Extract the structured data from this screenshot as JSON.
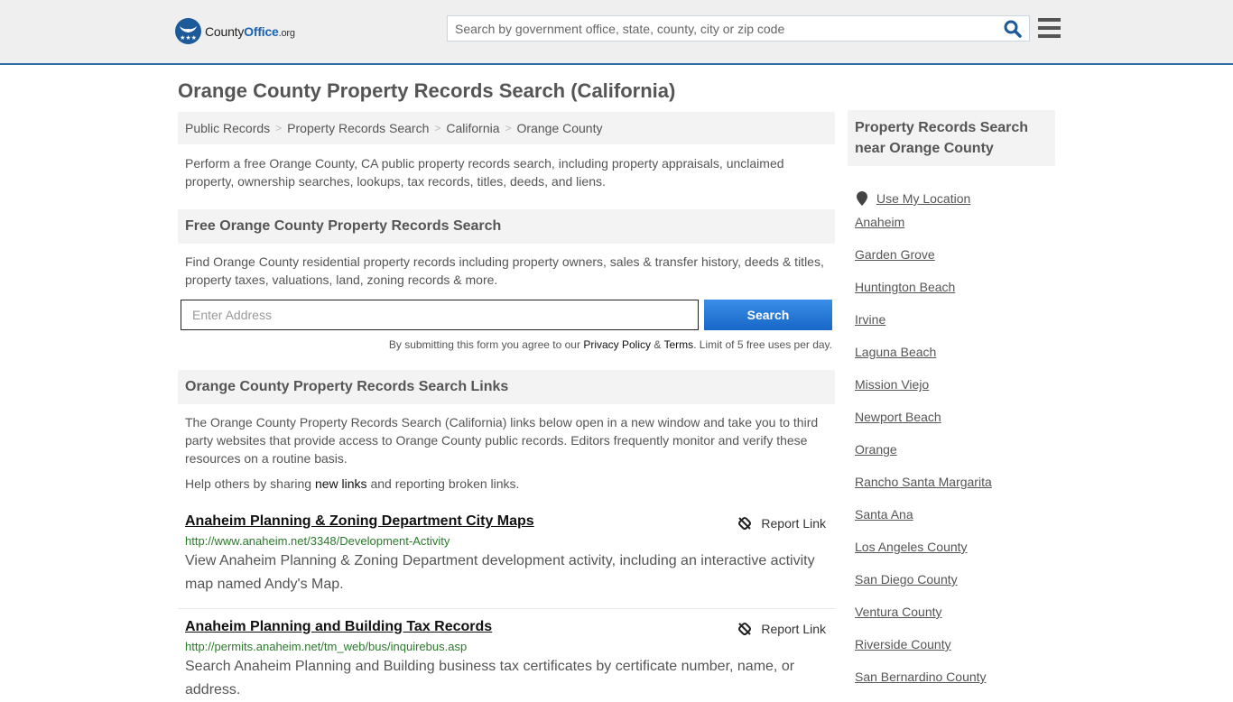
{
  "header": {
    "logo": {
      "name": "County",
      "brand": "Office",
      "tld": ".org"
    },
    "search_placeholder": "Search by government office, state, county, city or zip code",
    "search_icon": "search-icon",
    "menu_icon": "hamburger-menu-icon"
  },
  "page_title": "Orange County Property Records Search (California)",
  "breadcrumb": [
    {
      "label": "Public Records"
    },
    {
      "label": "Property Records Search"
    },
    {
      "label": "California"
    },
    {
      "label": "Orange County"
    }
  ],
  "breadcrumb_separator": ">",
  "intro": "Perform a free Orange County, CA public property records search, including property appraisals, unclaimed property, ownership searches, lookups, tax records, titles, deeds, and liens.",
  "free_search": {
    "heading": "Free Orange County Property Records Search",
    "description": "Find Orange County residential property records including property owners, sales & transfer history, deeds & titles, property taxes, valuations, land, zoning records & more.",
    "address_placeholder": "Enter Address",
    "button_label": "Search",
    "disclaimer_prefix": "By submitting this form you agree to our ",
    "privacy_label": "Privacy Policy",
    "amp": " & ",
    "terms_label": "Terms",
    "disclaimer_suffix": ". Limit of 5 free uses per day."
  },
  "links_section": {
    "heading": "Orange County Property Records Search Links",
    "description": "The Orange County Property Records Search (California) links below open in a new window and take you to third party websites that provide access to Orange County public records. Editors frequently monitor and verify these resources on a routine basis.",
    "help_prefix": "Help others by sharing ",
    "help_link": "new links",
    "help_suffix": " and reporting broken links.",
    "report_label": "Report Link",
    "items": [
      {
        "title": "Anaheim Planning & Zoning Department City Maps",
        "url": "http://www.anaheim.net/3348/Development-Activity",
        "description": "View Anaheim Planning & Zoning Department development activity, including an interactive activity map named Andy's Map."
      },
      {
        "title": "Anaheim Planning and Building Tax Records",
        "url": "http://permits.anaheim.net/tm_web/bus/inquirebus.asp",
        "description": "Search Anaheim Planning and Building business tax certificates by certificate number, name, or address."
      }
    ]
  },
  "sidebar": {
    "heading": "Property Records Search near Orange County",
    "use_location": "Use My Location",
    "places": [
      "Anaheim",
      "Garden Grove",
      "Huntington Beach",
      "Irvine",
      "Laguna Beach",
      "Mission Viejo",
      "Newport Beach",
      "Orange",
      "Rancho Santa Margarita",
      "Santa Ana",
      "Los Angeles County",
      "San Diego County",
      "Ventura County",
      "Riverside County",
      "San Bernardino County"
    ]
  }
}
